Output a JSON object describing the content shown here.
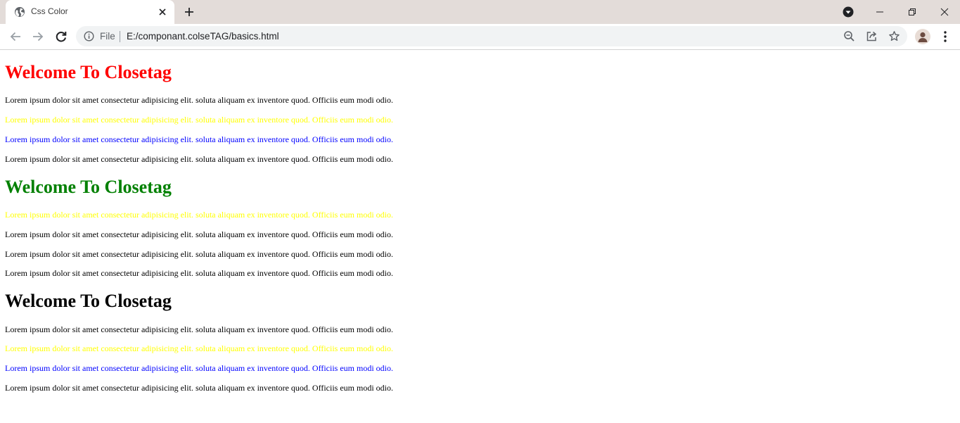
{
  "browser": {
    "tab": {
      "title": "Css Color"
    },
    "omnibox": {
      "scheme": "File",
      "url": "E:/componant.colseTAG/basics.html"
    }
  },
  "colors": {
    "red": "#ff0000",
    "yellow": "#ffff00",
    "blue": "#0000ff",
    "green": "#008000",
    "black": "#000000"
  },
  "page": {
    "sections": [
      {
        "heading": "Welcome To Closetag",
        "heading_color": "red",
        "paragraphs": [
          {
            "text": "Lorem ipsum dolor sit amet consectetur adipisicing elit. soluta aliquam ex inventore quod. Officiis eum modi odio.",
            "color": "black"
          },
          {
            "text": "Lorem ipsum dolor sit amet consectetur adipisicing elit. soluta aliquam ex inventore quod. Officiis eum modi odio.",
            "color": "yellow"
          },
          {
            "text": "Lorem ipsum dolor sit amet consectetur adipisicing elit. soluta aliquam ex inventore quod. Officiis eum modi odio.",
            "color": "blue"
          },
          {
            "text": "Lorem ipsum dolor sit amet consectetur adipisicing elit. soluta aliquam ex inventore quod. Officiis eum modi odio.",
            "color": "black"
          }
        ]
      },
      {
        "heading": "Welcome To Closetag",
        "heading_color": "green",
        "paragraphs": [
          {
            "text": "Lorem ipsum dolor sit amet consectetur adipisicing elit. soluta aliquam ex inventore quod. Officiis eum modi odio.",
            "color": "yellow"
          },
          {
            "text": "Lorem ipsum dolor sit amet consectetur adipisicing elit. soluta aliquam ex inventore quod. Officiis eum modi odio.",
            "color": "black"
          },
          {
            "text": "Lorem ipsum dolor sit amet consectetur adipisicing elit. soluta aliquam ex inventore quod. Officiis eum modi odio.",
            "color": "black"
          },
          {
            "text": "Lorem ipsum dolor sit amet consectetur adipisicing elit. soluta aliquam ex inventore quod. Officiis eum modi odio.",
            "color": "black"
          }
        ]
      },
      {
        "heading": "Welcome To Closetag",
        "heading_color": "black",
        "paragraphs": [
          {
            "text": "Lorem ipsum dolor sit amet consectetur adipisicing elit. soluta aliquam ex inventore quod. Officiis eum modi odio.",
            "color": "black"
          },
          {
            "text": "Lorem ipsum dolor sit amet consectetur adipisicing elit. soluta aliquam ex inventore quod. Officiis eum modi odio.",
            "color": "yellow"
          },
          {
            "text": "Lorem ipsum dolor sit amet consectetur adipisicing elit. soluta aliquam ex inventore quod. Officiis eum modi odio.",
            "color": "blue"
          },
          {
            "text": "Lorem ipsum dolor sit amet consectetur adipisicing elit. soluta aliquam ex inventore quod. Officiis eum modi odio.",
            "color": "black"
          }
        ]
      }
    ]
  },
  "icons": {
    "tab_favicon": "globe-icon",
    "tab_close": "close-icon",
    "new_tab": "plus-icon",
    "tab_search": "tab-search-icon",
    "minimize": "minimize-icon",
    "maximize": "restore-icon",
    "close_window": "close-icon",
    "back": "arrow-left-icon",
    "forward": "arrow-right-icon",
    "reload": "reload-icon",
    "site_info": "info-icon",
    "zoom": "zoom-icon",
    "share": "share-icon",
    "bookmark": "star-icon",
    "profile": "avatar-icon",
    "menu": "kebab-menu-icon"
  }
}
